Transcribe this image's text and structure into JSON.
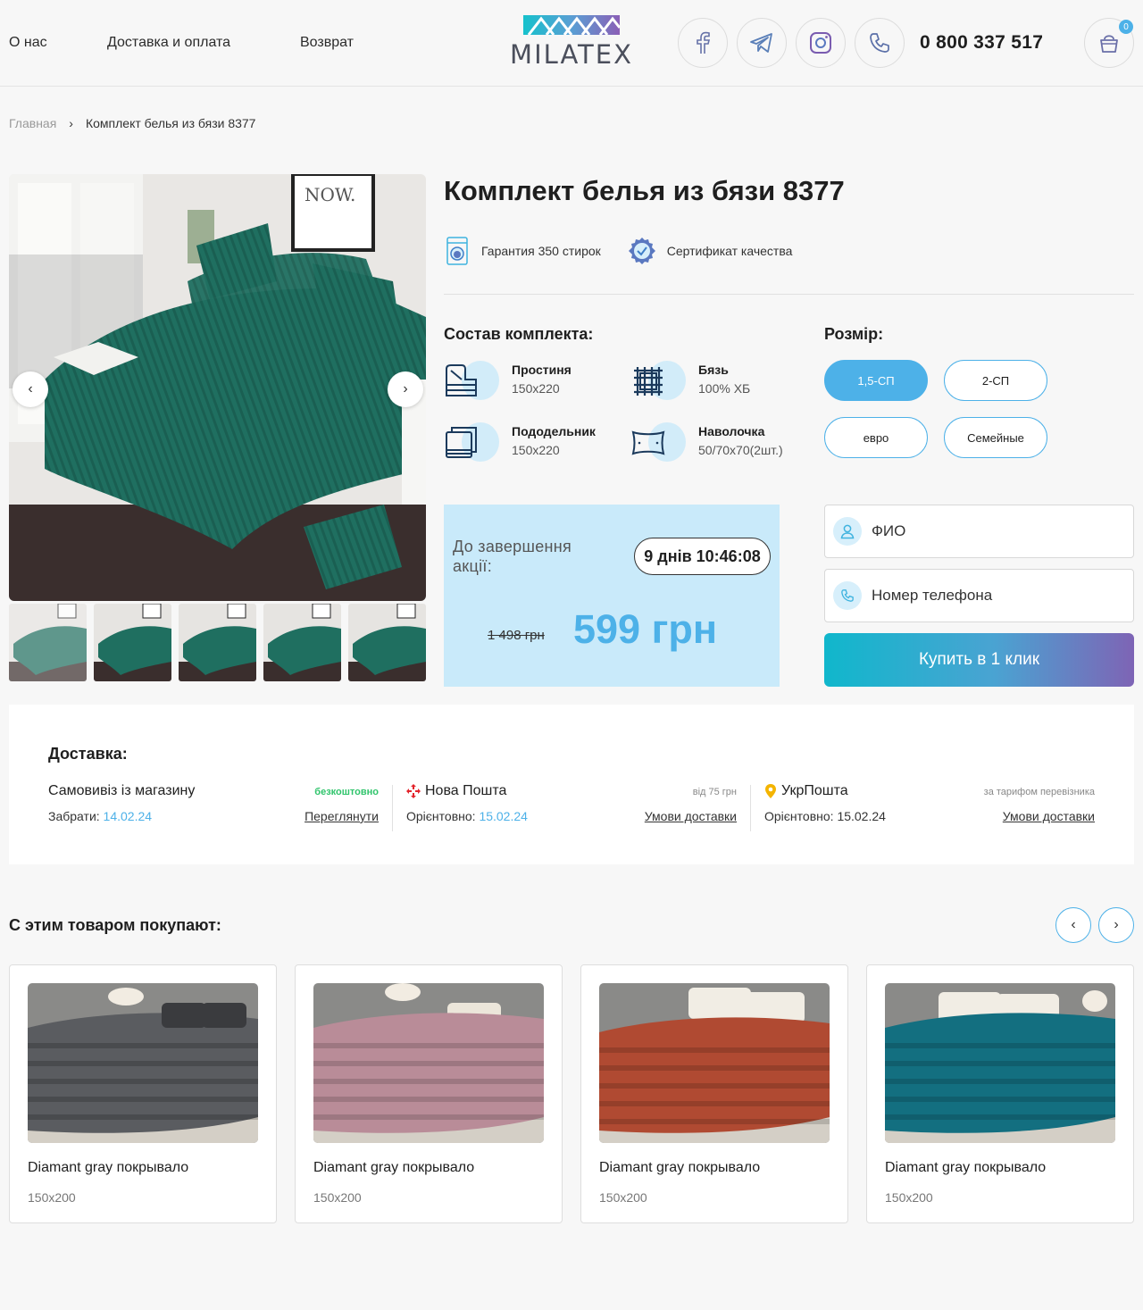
{
  "header": {
    "nav": [
      "О нас",
      "Доставка и оплата",
      "Возврат"
    ],
    "logo_text": "MILATEX",
    "phone": "0 800 337 517",
    "cart_count": "0"
  },
  "breadcrumb": {
    "home": "Главная",
    "separator": "›",
    "current": "Комплект белья из бязи 8377"
  },
  "product": {
    "title": "Комплект белья из бязи 8377",
    "badges": [
      "Гарантия 350 стирок",
      "Сертификат качества"
    ],
    "composition_title": "Состав комплекта:",
    "composition": [
      {
        "name": "Простиня",
        "value": "150x220",
        "icon": "sheet-icon"
      },
      {
        "name": "Бязь",
        "value": "100% ХБ",
        "icon": "fabric-icon"
      },
      {
        "name": "Пододельник",
        "value": "150x220",
        "icon": "duvet-cover-icon"
      },
      {
        "name": "Наволочка",
        "value": "50/70x70(2шт.)",
        "icon": "pillowcase-icon"
      }
    ],
    "size_title": "Розмір:",
    "sizes": [
      "1,5-СП",
      "2-СП",
      "евро",
      "Семейные"
    ],
    "selected_size": "1,5-СП",
    "promo_label": "До завершення акції:",
    "timer": "9 днів 10:46:08",
    "old_price": "1 498 грн",
    "new_price": "599 грн"
  },
  "form": {
    "name_placeholder": "ФИО",
    "phone_placeholder": "Номер телефона",
    "buy_label": "Купить в 1 клик"
  },
  "delivery": {
    "title": "Доставка:",
    "options": [
      {
        "name": "Самовивіз із магазину",
        "note": "безкоштовно",
        "date_label": "Забрати:",
        "date": "14.02.24",
        "link": "Переглянути"
      },
      {
        "name": "Нова Пошта",
        "note": "від 75 грн",
        "date_label": "Орієнтовно:",
        "date": "15.02.24",
        "link": "Умови доставки"
      },
      {
        "name": "УкрПошта",
        "note": "за тарифом перевізника",
        "date_label": "Орієнтовно:",
        "date": "15.02.24",
        "link": "Умови доставки"
      }
    ]
  },
  "related": {
    "title": "С этим товаром покупают:",
    "items": [
      {
        "name": "Diamant gray покрывало",
        "size": "150x200",
        "color": "#5a5c60"
      },
      {
        "name": "Diamant gray покрывало",
        "size": "150x200",
        "color": "#b98c98"
      },
      {
        "name": "Diamant gray покрывало",
        "size": "150x200",
        "color": "#b04a32"
      },
      {
        "name": "Diamant gray покрывало",
        "size": "150x200",
        "color": "#136f80"
      }
    ]
  },
  "colors": {
    "accent": "#4db1e8",
    "promo_bg": "#c9eafa",
    "bedding_green": "#1f6f60",
    "free_green": "#2fc46b"
  }
}
